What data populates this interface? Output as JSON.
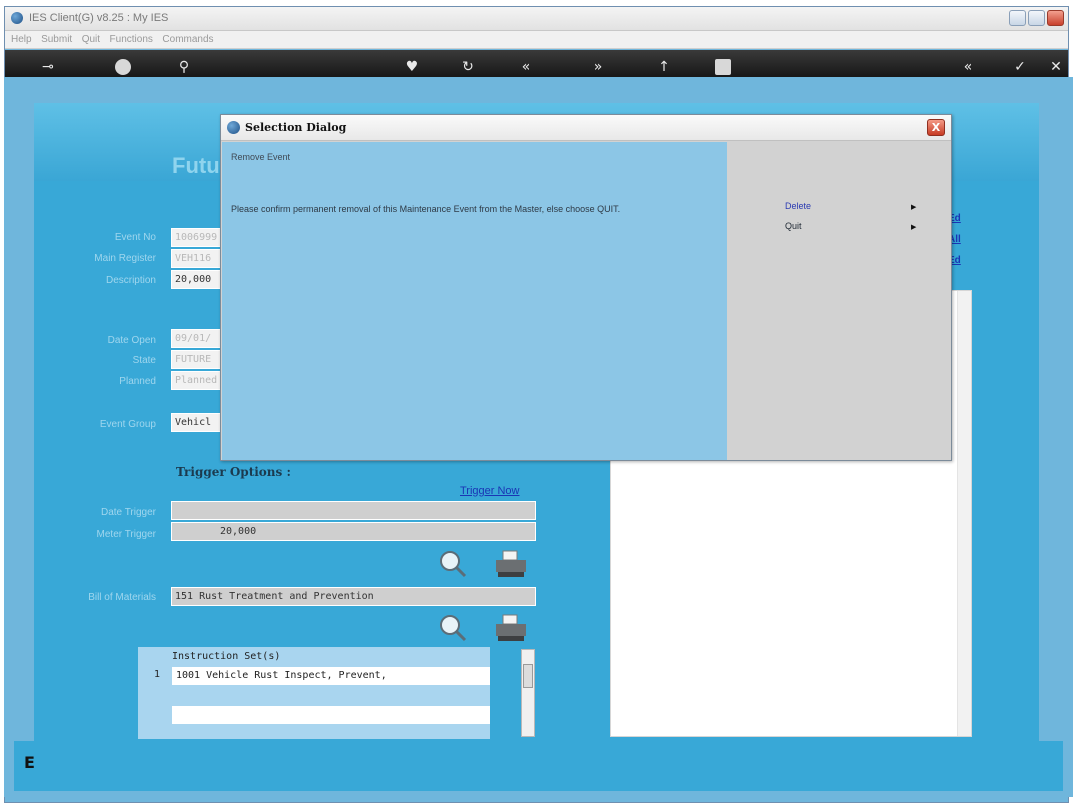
{
  "window": {
    "title": "IES Client(G) v8.25 : My IES"
  },
  "menubar": {
    "items": [
      "Help",
      "Submit",
      "Quit",
      "Functions",
      "Commands"
    ]
  },
  "toolbar": {
    "icons": [
      "key-icon",
      "help-icon",
      "search-icon",
      "heart-icon",
      "refresh-icon",
      "rewind-icon",
      "fast-forward-icon",
      "up-icon",
      "stop-icon",
      "fast-back-icon",
      "check-icon",
      "close-icon"
    ]
  },
  "form": {
    "title": "Futu",
    "fields": {
      "event_no": {
        "label": "Event No",
        "value": "1006999"
      },
      "main_register": {
        "label": "Main Register",
        "value": "VEH116"
      },
      "description": {
        "label": "Description",
        "value": "20,000"
      },
      "date_open": {
        "label": "Date Open",
        "value": "09/01/"
      },
      "state": {
        "label": "State",
        "value": "FUTURE"
      },
      "planned": {
        "label": "Planned",
        "value": "Planned"
      },
      "event_group": {
        "label": "Event Group",
        "value": "Vehicl"
      }
    },
    "right_links": [
      "Ed",
      "All",
      "Ed"
    ],
    "trigger": {
      "section_title": "Trigger Options :",
      "trigger_now": "Trigger Now",
      "date_trigger_label": "Date Trigger",
      "date_trigger_value": "",
      "meter_trigger_label": "Meter Trigger",
      "meter_trigger_value": "20,000"
    },
    "bill_of_materials": {
      "label": "Bill of Materials",
      "value": "151 Rust Treatment and Prevention"
    },
    "instruction_set": {
      "header": "Instruction Set(s)",
      "rows": [
        {
          "num": "1",
          "text": "1001 Vehicle Rust Inspect, Prevent,"
        }
      ]
    },
    "bottom_letter": "E"
  },
  "dialog": {
    "title": "Selection Dialog",
    "heading": "Remove Event",
    "message": "Please confirm permanent removal of this Maintenance Event from the Master, else choose QUIT.",
    "options": [
      {
        "label": "Delete",
        "active": true
      },
      {
        "label": "Quit",
        "active": false
      }
    ],
    "close_label": "X"
  }
}
